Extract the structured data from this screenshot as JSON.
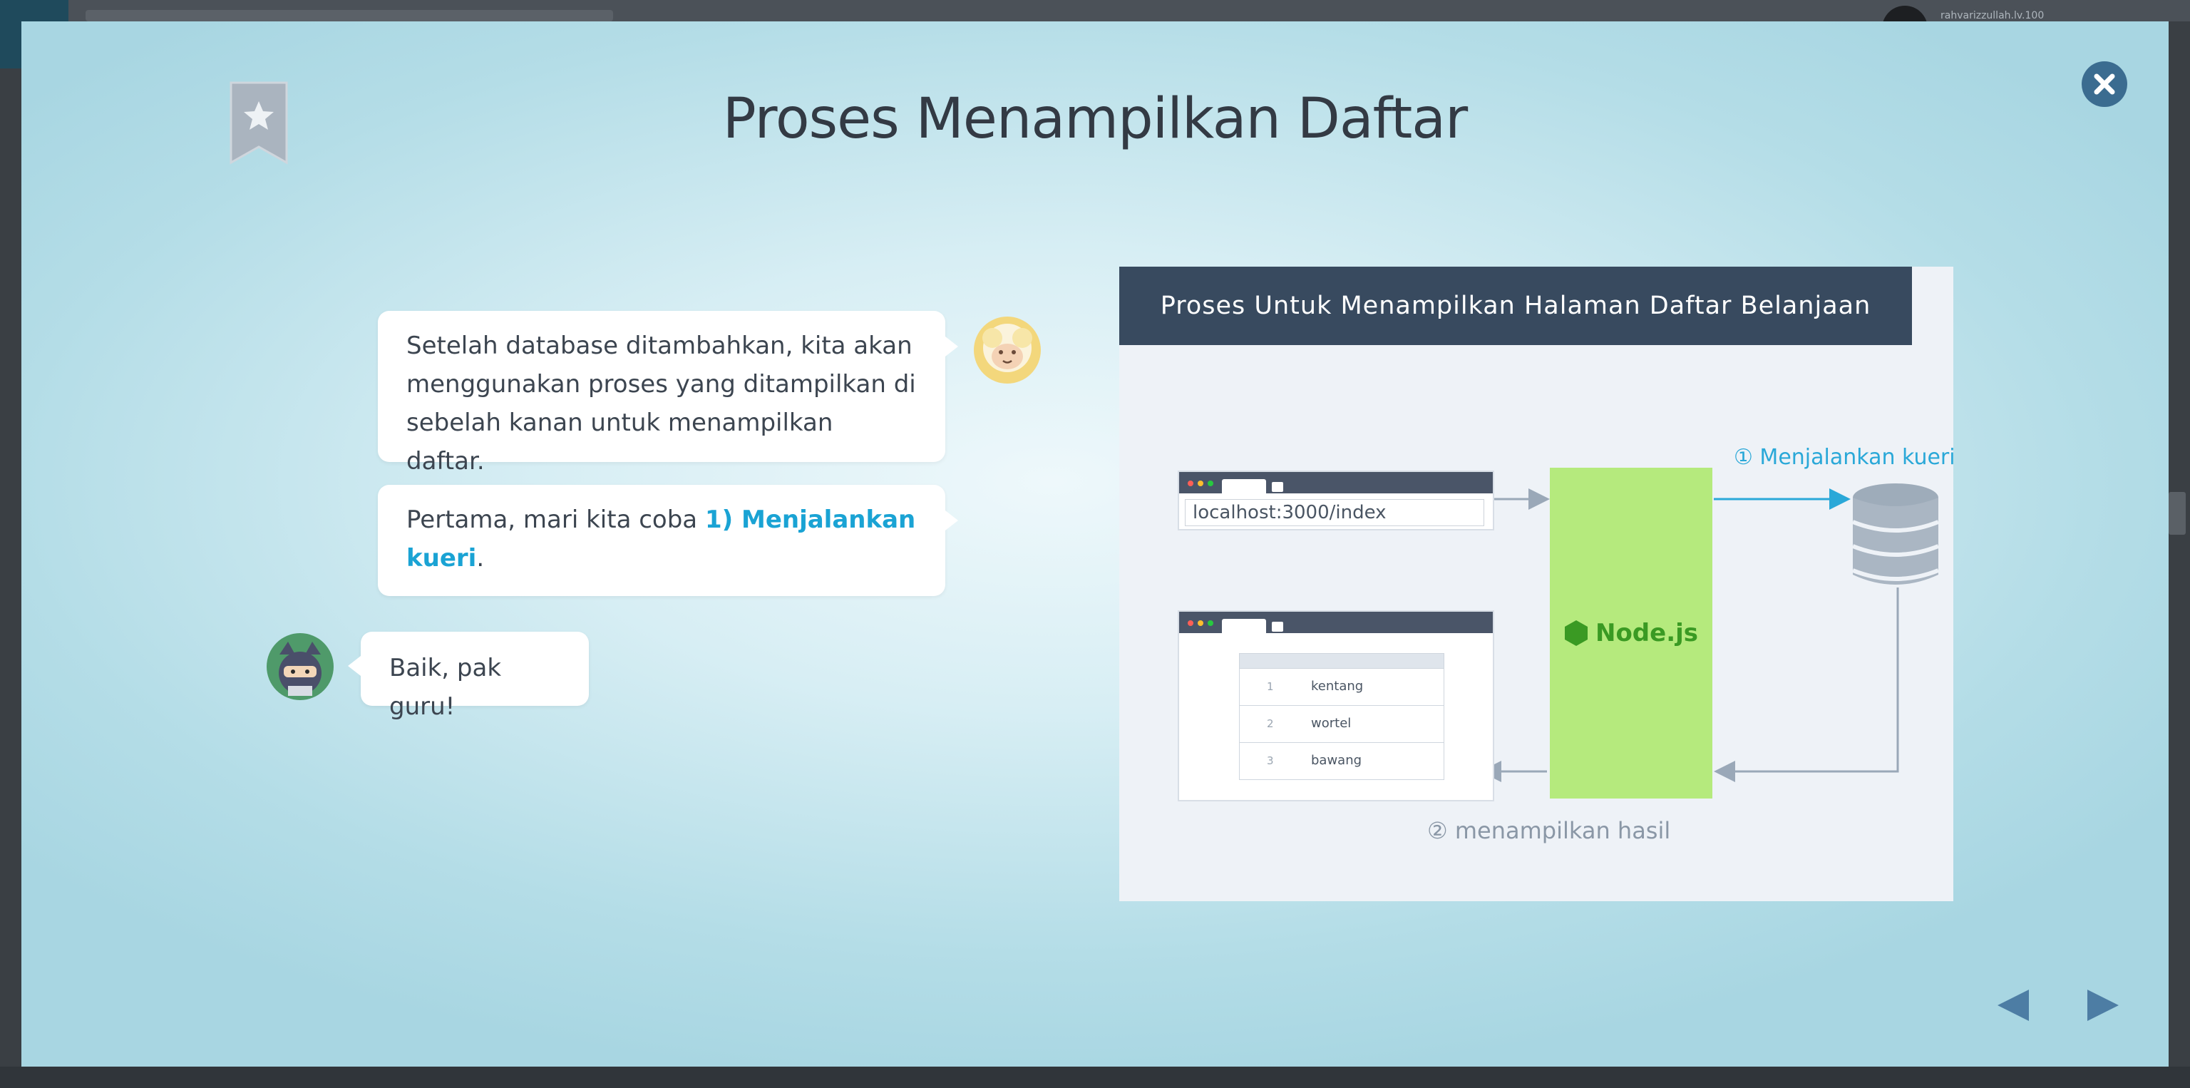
{
  "modal": {
    "title": "Proses Menampilkan Daftar"
  },
  "background": {
    "user_label": "rahvarizzullah.lv.100"
  },
  "chat": {
    "bubble1": "Setelah database ditambahkan, kita akan menggunakan proses yang ditampilkan di sebelah kanan untuk menampilkan daftar.",
    "bubble2_prefix": "Pertama, mari kita coba ",
    "bubble2_highlight": "1) Menjalankan kueri",
    "bubble2_suffix": ".",
    "bubble3": "Baik, pak guru!"
  },
  "diagram": {
    "header": "Proses Untuk Menampilkan Halaman Daftar Belanjaan",
    "url": "localhost:3000/index",
    "server_label": "Node.js",
    "step1_label": "① Menjalankan kueri",
    "step2_label": "② menampilkan hasil",
    "items": [
      {
        "n": "1",
        "name": "kentang"
      },
      {
        "n": "2",
        "name": "wortel"
      },
      {
        "n": "3",
        "name": "bawang"
      }
    ]
  },
  "colors": {
    "accent": "#1aa3d4",
    "header_bg": "#384a5f",
    "node_bg": "#b5ea7d",
    "node_text": "#3a9a23",
    "close_bg": "#3b6c90"
  },
  "icons": {
    "bookmark": "bookmark-star-icon",
    "close": "close-icon",
    "database": "database-icon",
    "prev": "triangle-left-icon",
    "next": "triangle-right-icon"
  }
}
